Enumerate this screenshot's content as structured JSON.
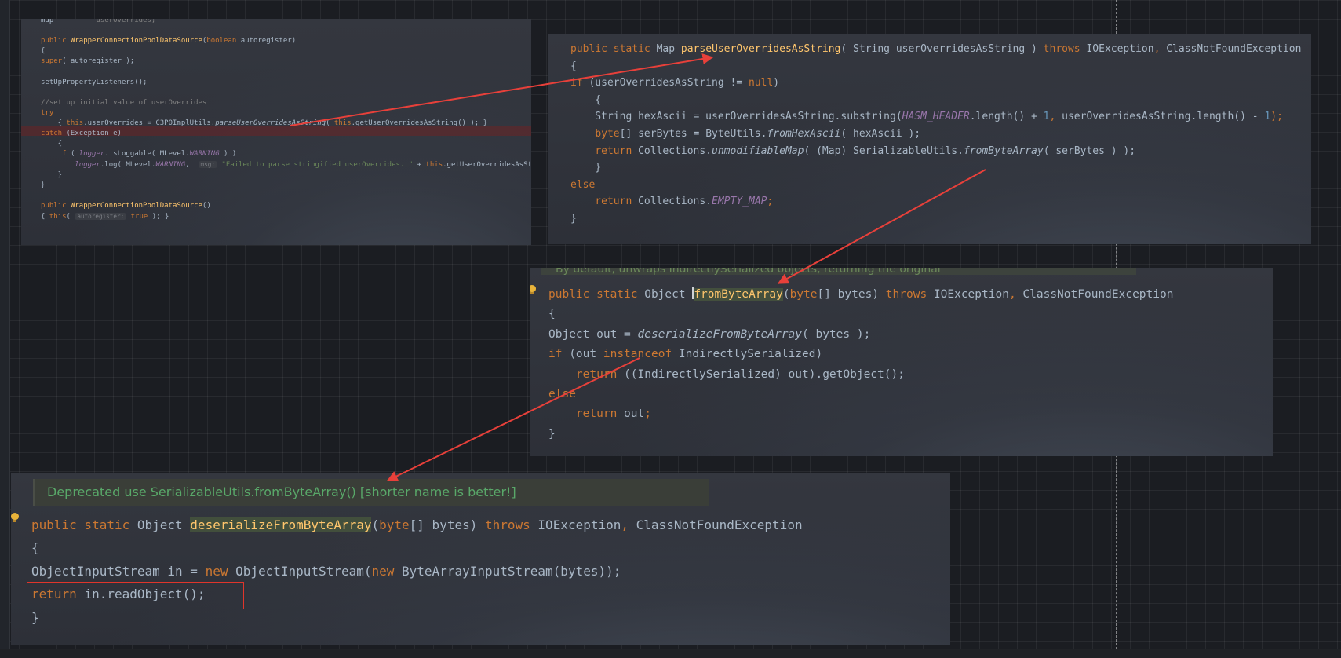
{
  "panel_1": {
    "lines": [
      [
        {
          "t": "map          ",
          "c": ""
        },
        {
          "t": "userOverrides;",
          "c": "cmt"
        }
      ],
      [],
      [
        {
          "t": "public ",
          "c": "kw"
        },
        {
          "t": "WrapperConnectionPoolDataSource",
          "c": "fn"
        },
        {
          "t": "(",
          "c": ""
        },
        {
          "t": "boolean ",
          "c": "kw"
        },
        {
          "t": "autoregister)",
          "c": ""
        }
      ],
      [
        {
          "t": "{",
          "c": ""
        }
      ],
      [
        {
          "t": "super",
          "c": "kw"
        },
        {
          "t": "( autoregister );",
          "c": ""
        }
      ],
      [],
      [
        {
          "t": "setUpPropertyListeners();",
          "c": ""
        }
      ],
      [],
      [
        {
          "t": "//set up initial value of userOverrides",
          "c": "cmt"
        }
      ],
      [
        {
          "t": "try",
          "c": "kw"
        }
      ],
      [
        {
          "t": "    { ",
          "c": ""
        },
        {
          "t": "this",
          "c": "kw"
        },
        {
          "t": ".userOverrides = C3P0ImplUtils.",
          "c": ""
        },
        {
          "t": "parseUserOverridesAsString",
          "c": "ital"
        },
        {
          "t": "( ",
          "c": ""
        },
        {
          "t": "this",
          "c": "kw"
        },
        {
          "t": ".getUserOverridesAsString() ); }",
          "c": ""
        }
      ],
      [
        {
          "t": "catch ",
          "c": "kw"
        },
        {
          "t": "(Exception e)",
          "c": ""
        }
      ],
      [
        {
          "t": "    {",
          "c": ""
        }
      ],
      [
        {
          "t": "    ",
          "c": ""
        },
        {
          "t": "if ",
          "c": "kw"
        },
        {
          "t": "( ",
          "c": ""
        },
        {
          "t": "logger",
          "c": "static-f"
        },
        {
          "t": ".isLoggable( MLevel.",
          "c": ""
        },
        {
          "t": "WARNING",
          "c": "static-f"
        },
        {
          "t": " ) )",
          "c": ""
        }
      ],
      [
        {
          "t": "        ",
          "c": ""
        },
        {
          "t": "logger",
          "c": "static-f"
        },
        {
          "t": ".log( MLevel.",
          "c": ""
        },
        {
          "t": "WARNING",
          "c": "static-f"
        },
        {
          "t": ",  ",
          "c": ""
        },
        {
          "t": "msg:",
          "c": "hint"
        },
        {
          "t": " \"Failed to parse stringified userOverrides. \" ",
          "c": "str"
        },
        {
          "t": "+ ",
          "c": ""
        },
        {
          "t": "this",
          "c": "kw"
        },
        {
          "t": ".getUserOverridesAsString()",
          "c": ""
        }
      ],
      [
        {
          "t": "    }",
          "c": ""
        }
      ],
      [
        {
          "t": "}",
          "c": ""
        }
      ],
      [],
      [
        {
          "t": "public ",
          "c": "kw"
        },
        {
          "t": "WrapperConnectionPoolDataSource",
          "c": "fn"
        },
        {
          "t": "()",
          "c": ""
        }
      ],
      [
        {
          "t": "{ ",
          "c": ""
        },
        {
          "t": "this",
          "c": "kw"
        },
        {
          "t": "( ",
          "c": ""
        },
        {
          "t": "autoregister:",
          "c": "hint"
        },
        {
          "t": " ",
          "c": ""
        },
        {
          "t": "true",
          "c": "kw"
        },
        {
          "t": " ); }",
          "c": ""
        }
      ]
    ]
  },
  "panel_2": {
    "lines": [
      [
        {
          "t": "public static ",
          "c": "kw"
        },
        {
          "t": "Map ",
          "c": ""
        },
        {
          "t": "parseUserOverridesAsString",
          "c": "fn"
        },
        {
          "t": "( String userOverridesAsString ) ",
          "c": ""
        },
        {
          "t": "throws ",
          "c": "kw"
        },
        {
          "t": "IOException",
          "c": ""
        },
        {
          "t": ", ",
          "c": "kw"
        },
        {
          "t": "ClassNotFoundException",
          "c": ""
        }
      ],
      [
        {
          "t": "{",
          "c": ""
        }
      ],
      [
        {
          "t": "if ",
          "c": "kw"
        },
        {
          "t": "(userOverridesAsString != ",
          "c": ""
        },
        {
          "t": "null",
          "c": "kw"
        },
        {
          "t": ")",
          "c": ""
        }
      ],
      [
        {
          "t": "    {",
          "c": ""
        }
      ],
      [
        {
          "t": "    String hexAscii = userOverridesAsString.substring(",
          "c": ""
        },
        {
          "t": "HASM_HEADER",
          "c": "static-f"
        },
        {
          "t": ".length() + ",
          "c": ""
        },
        {
          "t": "1",
          "c": "num"
        },
        {
          "t": ", ",
          "c": "kw"
        },
        {
          "t": "userOverridesAsString.length() - ",
          "c": ""
        },
        {
          "t": "1",
          "c": "num"
        },
        {
          "t": ");",
          "c": "kw"
        }
      ],
      [
        {
          "t": "    ",
          "c": ""
        },
        {
          "t": "byte",
          "c": "kw"
        },
        {
          "t": "[] serBytes = ByteUtils.",
          "c": ""
        },
        {
          "t": "fromHexAscii",
          "c": "ital"
        },
        {
          "t": "( hexAscii );",
          "c": ""
        }
      ],
      [
        {
          "t": "    ",
          "c": ""
        },
        {
          "t": "return ",
          "c": "kw"
        },
        {
          "t": "Collections.",
          "c": ""
        },
        {
          "t": "unmodifiableMap",
          "c": "ital"
        },
        {
          "t": "( (Map) SerializableUtils.",
          "c": ""
        },
        {
          "t": "fromByteArray",
          "c": "ital"
        },
        {
          "t": "( serBytes ) );",
          "c": ""
        }
      ],
      [
        {
          "t": "    }",
          "c": ""
        }
      ],
      [
        {
          "t": "else",
          "c": "kw"
        }
      ],
      [
        {
          "t": "    ",
          "c": ""
        },
        {
          "t": "return ",
          "c": "kw"
        },
        {
          "t": "Collections.",
          "c": ""
        },
        {
          "t": "EMPTY_MAP",
          "c": "static-f"
        },
        {
          "t": ";",
          "c": "kw"
        }
      ],
      [
        {
          "t": "}",
          "c": ""
        }
      ]
    ]
  },
  "panel_3": {
    "doc_text": "By default, unwraps IndirectlySerialized objects, returning the original",
    "lines": [
      [
        {
          "t": "public static ",
          "c": "kw"
        },
        {
          "t": "Object ",
          "c": ""
        },
        {
          "t": "|",
          "c": "caret"
        },
        {
          "t": "fromByteArray",
          "c": "hl-fn"
        },
        {
          "t": "(",
          "c": ""
        },
        {
          "t": "byte",
          "c": "kw"
        },
        {
          "t": "[] bytes) ",
          "c": ""
        },
        {
          "t": "throws ",
          "c": "kw"
        },
        {
          "t": "IOException",
          "c": ""
        },
        {
          "t": ", ",
          "c": "kw"
        },
        {
          "t": "ClassNotFoundException",
          "c": ""
        }
      ],
      [
        {
          "t": "{",
          "c": ""
        }
      ],
      [
        {
          "t": "Object out = ",
          "c": ""
        },
        {
          "t": "deserializeFromByteArray",
          "c": "ital"
        },
        {
          "t": "( bytes );",
          "c": ""
        }
      ],
      [
        {
          "t": "if ",
          "c": "kw"
        },
        {
          "t": "(out ",
          "c": ""
        },
        {
          "t": "instanceof ",
          "c": "kw"
        },
        {
          "t": "IndirectlySerialized)",
          "c": ""
        }
      ],
      [
        {
          "t": "    ",
          "c": ""
        },
        {
          "t": "return ",
          "c": "kw"
        },
        {
          "t": "((IndirectlySerialized) out).getObject();",
          "c": ""
        }
      ],
      [
        {
          "t": "else",
          "c": "kw"
        }
      ],
      [
        {
          "t": "    ",
          "c": ""
        },
        {
          "t": "return ",
          "c": "kw"
        },
        {
          "t": "out",
          "c": ""
        },
        {
          "t": ";",
          "c": "kw"
        }
      ],
      [
        {
          "t": "}",
          "c": ""
        }
      ]
    ]
  },
  "panel_4": {
    "doc_text": "Deprecated use SerializableUtils.fromByteArray() [shorter name is better!]",
    "lines": [
      [
        {
          "t": "public static ",
          "c": "kw"
        },
        {
          "t": "Object ",
          "c": ""
        },
        {
          "t": "deserializeFromByteArray",
          "c": "hl-fn"
        },
        {
          "t": "(",
          "c": ""
        },
        {
          "t": "byte",
          "c": "kw"
        },
        {
          "t": "[] bytes) ",
          "c": ""
        },
        {
          "t": "throws ",
          "c": "kw"
        },
        {
          "t": "IOException",
          "c": ""
        },
        {
          "t": ", ",
          "c": "kw"
        },
        {
          "t": "ClassNotFoundException",
          "c": ""
        }
      ],
      [
        {
          "t": "{",
          "c": ""
        }
      ],
      [
        {
          "t": "ObjectInputStream in = ",
          "c": ""
        },
        {
          "t": "new ",
          "c": "kw"
        },
        {
          "t": "ObjectInputStream(",
          "c": ""
        },
        {
          "t": "new ",
          "c": "kw"
        },
        {
          "t": "ByteArrayInputStream(bytes));",
          "c": ""
        }
      ],
      [
        {
          "t": "return ",
          "c": "kw"
        },
        {
          "t": "in.readObject();",
          "c": ""
        }
      ],
      [
        {
          "t": "}",
          "c": ""
        }
      ]
    ]
  },
  "colors": {
    "arrow": "#e8403a",
    "keyword": "#cc7832",
    "method": "#ffc66d",
    "number": "#6897bb",
    "string": "#6a8759",
    "static_field": "#9876aa",
    "plain": "#a9b7c6"
  }
}
